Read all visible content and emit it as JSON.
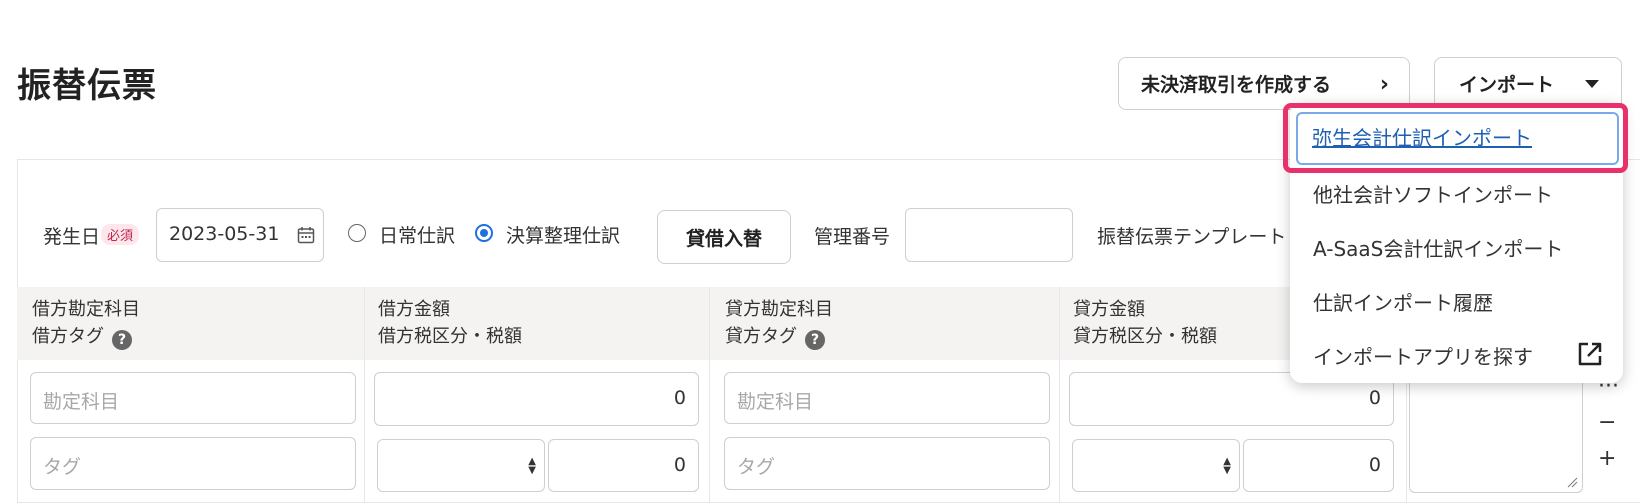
{
  "page": {
    "title": "振替伝票",
    "unsettled_button": "未決済取引を作成する",
    "import_button": "インポート"
  },
  "form": {
    "date_label": "発生日",
    "required_badge": "必須",
    "date_value": "2023-05-31",
    "radio_normal": "日常仕訳",
    "radio_closing": "決算整理仕訳",
    "selected_radio": "決算整理仕訳",
    "swap_button": "貸借入替",
    "mgmt_label": "管理番号",
    "mgmt_value": "",
    "template_label": "振替伝票テンプレート"
  },
  "table": {
    "debit_account_header": "借方勘定科目",
    "debit_tag_header": "借方タグ",
    "debit_amount_header": "借方金額",
    "debit_tax_header": "借方税区分・税額",
    "credit_account_header": "貸方勘定科目",
    "credit_tag_header": "貸方タグ",
    "credit_amount_header": "貸方金額",
    "credit_tax_header": "貸方税区分・税額",
    "help_mark": "?",
    "account_placeholder": "勘定科目",
    "tag_placeholder": "タグ",
    "debit_amount": "0",
    "debit_tax": "0",
    "credit_amount": "0",
    "credit_tax": "0"
  },
  "side_controls": {
    "more": "···",
    "minus": "−",
    "plus": "+"
  },
  "dropdown": {
    "items": [
      "弥生会計仕訳インポート",
      "他社会計ソフトインポート",
      "A-SaaS会計仕訳インポート",
      "仕訳インポート履歴",
      "インポートアプリを探す"
    ]
  },
  "colors": {
    "highlight_border": "#e8306a",
    "radio_accent": "#1e6fe0",
    "link": "#1e5fb3",
    "header_bg": "#f4f3f2"
  }
}
